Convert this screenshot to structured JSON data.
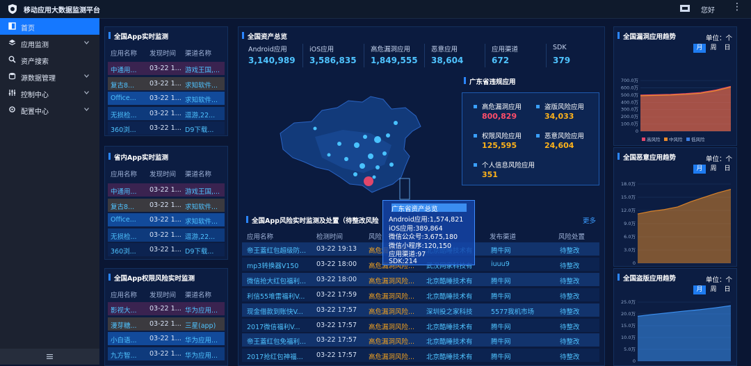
{
  "header": {
    "app_title": "移动应用大数据监测平台",
    "greeting": "您好",
    "more": "⋮"
  },
  "sidebar": {
    "items": [
      {
        "label": "首页",
        "active": true,
        "chevron": false
      },
      {
        "label": "应用监测",
        "active": false,
        "chevron": true
      },
      {
        "label": "资产搜索",
        "active": false,
        "chevron": false
      },
      {
        "label": "源数据管理",
        "active": false,
        "chevron": true
      },
      {
        "label": "控制中心",
        "active": false,
        "chevron": true
      },
      {
        "label": "配置中心",
        "active": false,
        "chevron": true
      }
    ],
    "icons": [
      "home-icon",
      "apps-icon",
      "search-icon",
      "database-icon",
      "sliders-icon",
      "gear-icon"
    ]
  },
  "left_panels": [
    {
      "title": "全国App实时监测",
      "headers": [
        "应用名称",
        "发现时间",
        "渠道名称"
      ],
      "rows": [
        {
          "name": "中通用...",
          "time": "03-22 1...",
          "channel": "游戏王国,...",
          "name_color": "#4fc3ff",
          "channel_color": "#4fc3ff",
          "bg": "#3a2350"
        },
        {
          "name": "复古8...",
          "time": "03-22 1...",
          "channel": "求知软件...",
          "name_color": "#4fc3ff",
          "channel_color": "#4fc3ff",
          "bg": "#3b3a3f"
        },
        {
          "name": "Office...",
          "time": "03-22 1...",
          "channel": "求知软件...",
          "name_color": "#4fc3ff",
          "channel_color": "#4fc3ff",
          "bg": "#124a9a"
        },
        {
          "name": "无损检...",
          "time": "03-22 1...",
          "channel": "逗游,22...",
          "name_color": "#4fc3ff",
          "channel_color": "#4fc3ff",
          "bg": "#0e3a7c"
        },
        {
          "name": "360浏...",
          "time": "03-22 1...",
          "channel": "D9下载...",
          "name_color": "#4fc3ff",
          "channel_color": "#4fc3ff",
          "bg": "#0c2350"
        }
      ]
    },
    {
      "title": "省内App实时监测",
      "headers": [
        "应用名称",
        "发现时间",
        "渠道名称"
      ],
      "rows": [
        {
          "name": "中通用...",
          "time": "03-22 1...",
          "channel": "游戏王国,...",
          "name_color": "#4fc3ff",
          "channel_color": "#4fc3ff",
          "bg": "#3a2350"
        },
        {
          "name": "复古8...",
          "time": "03-22 1...",
          "channel": "求知软件...",
          "name_color": "#4fc3ff",
          "channel_color": "#4fc3ff",
          "bg": "#3b3a3f"
        },
        {
          "name": "Office...",
          "time": "03-22 1...",
          "channel": "求知软件...",
          "name_color": "#4fc3ff",
          "channel_color": "#4fc3ff",
          "bg": "#124a9a"
        },
        {
          "name": "无损检...",
          "time": "03-22 1...",
          "channel": "逗游,22...",
          "name_color": "#4fc3ff",
          "channel_color": "#4fc3ff",
          "bg": "#0e3a7c"
        },
        {
          "name": "360浏...",
          "time": "03-22 1...",
          "channel": "D9下载...",
          "name_color": "#4fc3ff",
          "channel_color": "#4fc3ff",
          "bg": "#0c2350"
        }
      ]
    },
    {
      "title": "全国App权限风险实时监测",
      "headers": [
        "应用名称",
        "发现时间",
        "渠道名称"
      ],
      "rows": [
        {
          "name": "影视大...",
          "time": "03-22 1...",
          "channel": "华为应用...",
          "name_color": "#4fc3ff",
          "channel_color": "#4fc3ff",
          "bg": "#3a2350"
        },
        {
          "name": "漫芽糖...",
          "time": "03-22 1...",
          "channel": "三星(app)",
          "name_color": "#4fc3ff",
          "channel_color": "#4fc3ff",
          "bg": "#3b3a3f"
        },
        {
          "name": "小白语...",
          "time": "03-22 1...",
          "channel": "华为应用...",
          "name_color": "#4fc3ff",
          "channel_color": "#4fc3ff",
          "bg": "#124a9a"
        },
        {
          "name": "九方智...",
          "time": "03-22 1...",
          "channel": "华为应用...",
          "name_color": "#4fc3ff",
          "channel_color": "#4fc3ff",
          "bg": "#0e3a7c"
        }
      ]
    }
  ],
  "assets": {
    "title": "全国资产总览",
    "stats": [
      {
        "label": "Android应用",
        "value": "3,140,989"
      },
      {
        "label": "iOS应用",
        "value": "3,586,835"
      },
      {
        "label": "高危漏洞应用",
        "value": "1,849,555"
      },
      {
        "label": "恶意应用",
        "value": "38,604"
      },
      {
        "label": "应用渠道",
        "value": "672"
      },
      {
        "label": "SDK",
        "value": "379"
      }
    ]
  },
  "guangdong": {
    "title": "广东省违规应用",
    "items": [
      {
        "label": "高危漏洞应用",
        "value": "800,829",
        "color": "#ff4d6a"
      },
      {
        "label": "盗版风险应用",
        "value": "34,033",
        "color": "#ffb31a"
      },
      {
        "label": "权限风险应用",
        "value": "125,595",
        "color": "#ffb31a"
      },
      {
        "label": "恶意风险应用",
        "value": "24,604",
        "color": "#ffb31a"
      },
      {
        "label": "个人信息风险应用",
        "value": "351",
        "color": "#ffb31a"
      }
    ]
  },
  "tooltip": {
    "title": "广东省资产总览",
    "lines": [
      "Android应用:1,574,821",
      "iOS应用:389,864",
      "微信公众号:3,675,180",
      "微信小程序:120,150",
      "应用渠道:97",
      "SDK:214"
    ]
  },
  "risk_table": {
    "title": "全国App风险实时监测及处置（待整改风险",
    "more": "更多",
    "headers": [
      "应用名称",
      "检测时间",
      "风险",
      "",
      "发布渠道",
      "风险处置"
    ],
    "rows": [
      {
        "name": "帝王蓋红包超级防...",
        "time": "03-22 19:13",
        "risk": "高危漏洞风险...",
        "company": "北京酷睡技术有",
        "channel": "腾牛网",
        "status": "待整改",
        "bg": "#12336c"
      },
      {
        "name": "mp3转换器V150",
        "time": "03-22 18:00",
        "risk": "高危漏洞风险...",
        "company": "武汉网家科技有",
        "channel": "iuuu9",
        "status": "待整改",
        "bg": "#0c2350"
      },
      {
        "name": "微信抢大红包福利...",
        "time": "03-22 18:00",
        "risk": "高危漏洞风险...",
        "company": "北京酷睡技术有",
        "channel": "腾牛网",
        "status": "待整改",
        "bg": "#12336c"
      },
      {
        "name": "利信55堆雷福利V...",
        "time": "03-22 17:59",
        "risk": "高危漏洞风险...",
        "company": "北京酷睡技术有",
        "channel": "腾牛网",
        "status": "待整改",
        "bg": "#0c2350"
      },
      {
        "name": "现金借款到账快V...",
        "time": "03-22 17:57",
        "risk": "高危漏洞风险...",
        "company": "深圳投之家科技",
        "channel": "5577我机市场",
        "status": "待整改",
        "bg": "#12336c"
      },
      {
        "name": "2017微信福利V...",
        "time": "03-22 17:57",
        "risk": "高危漏洞风险...",
        "company": "北京酷睡技术有",
        "channel": "腾牛网",
        "status": "待整改",
        "bg": "#0c2350"
      },
      {
        "name": "帝王蓋红包免福利...",
        "time": "03-22 17:57",
        "risk": "高危漏洞风险...",
        "company": "北京酷睡技术有",
        "channel": "腾牛网",
        "status": "待整改",
        "bg": "#12336c"
      },
      {
        "name": "2017抢红包神福...",
        "time": "03-22 17:57",
        "risk": "高危漏洞风险...",
        "company": "北京酷睡技术有",
        "channel": "腾牛网",
        "status": "待整改",
        "bg": "#0c2350"
      }
    ]
  },
  "right_panels": [
    {
      "title": "全国漏洞应用趋势",
      "unit": "单位：个",
      "segments": [
        "月",
        "周",
        "日"
      ],
      "selected": "月"
    },
    {
      "title": "全国恶意应用趋势",
      "unit": "单位：个",
      "segments": [
        "月",
        "周",
        "日"
      ],
      "selected": "月"
    },
    {
      "title": "全国盗版应用趋势",
      "unit": "单位：个",
      "segments": [
        "月",
        "周",
        "日"
      ],
      "selected": "月"
    }
  ],
  "chart_data": [
    {
      "type": "area",
      "ylabels": [
        "700.0万",
        "600.0万",
        "500.0万",
        "400.0万",
        "300.0万",
        "200.0万",
        "100.0万",
        "0"
      ],
      "ylim": [
        0,
        7000000
      ],
      "legend": [
        "高风险",
        "中风险",
        "低风险"
      ],
      "series_colors": [
        "#e0476a",
        "#e88a2c",
        "#3a7ee6"
      ],
      "series": [
        {
          "name": "高风险",
          "values": [
            5000000,
            5050000,
            5100000,
            5200000,
            5350000,
            5700000,
            6200000
          ]
        },
        {
          "name": "中风险",
          "values": [
            4900000,
            4950000,
            5000000,
            5100000,
            5250000,
            5600000,
            6100000
          ]
        }
      ]
    },
    {
      "type": "area",
      "ylabels": [
        "18.0万",
        "15.0万",
        "12.0万",
        "9.0万",
        "6.0万",
        "3.0万",
        "0"
      ],
      "ylim": [
        0,
        180000
      ],
      "series_colors": [
        "#d9832a"
      ],
      "series": [
        {
          "values": [
            112000,
            118000,
            122000,
            128000,
            140000,
            150000,
            160000,
            168000
          ]
        }
      ]
    },
    {
      "type": "area",
      "ylabels": [
        "25.0万",
        "20.0万",
        "15.0万",
        "10.0万",
        "5.0万",
        "0"
      ],
      "ylim": [
        0,
        250000
      ],
      "series_colors": [
        "#3a8ff0"
      ],
      "series": [
        {
          "values": [
            190000,
            198000,
            205000,
            212000,
            218000,
            226000,
            235000
          ]
        }
      ]
    }
  ]
}
